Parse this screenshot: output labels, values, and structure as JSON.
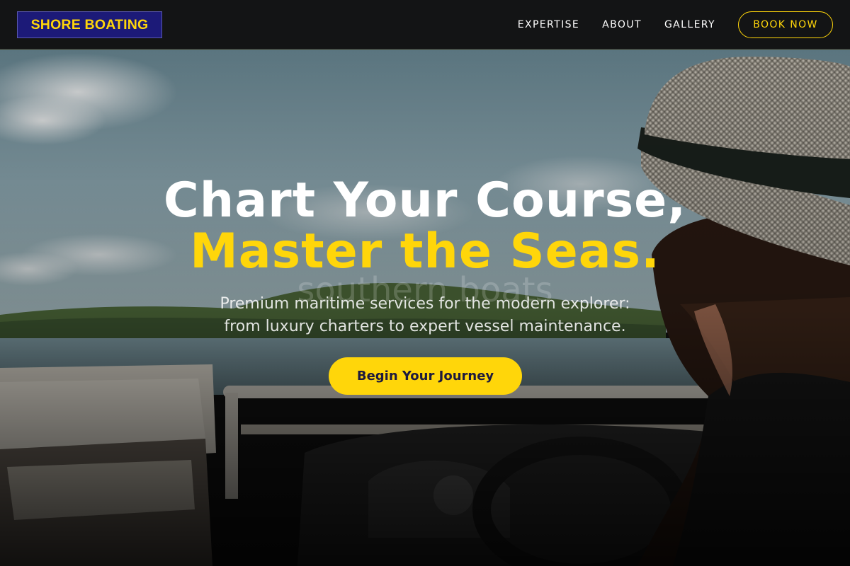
{
  "header": {
    "logo_text": "SHORE BOATING",
    "nav": [
      {
        "label": "EXPERTISE"
      },
      {
        "label": "ABOUT"
      },
      {
        "label": "GALLERY"
      }
    ],
    "cta_label": "BOOK NOW"
  },
  "hero": {
    "headline_line1": "Chart Your Course,",
    "headline_line2": "Master the Seas.",
    "watermark": "southern boats",
    "subtitle_line1": "Premium maritime services for the modern explorer:",
    "subtitle_line2": "from luxury charters to expert vessel maintenance.",
    "cta_label": "Begin Your Journey",
    "background_image": "man in straw hat steering pontoon boat on lake"
  },
  "colors": {
    "accent": "#ffd60a",
    "logo_bg": "#1c1a78",
    "navbar_bg": "#111111",
    "cta_text": "#1d1a3e"
  }
}
